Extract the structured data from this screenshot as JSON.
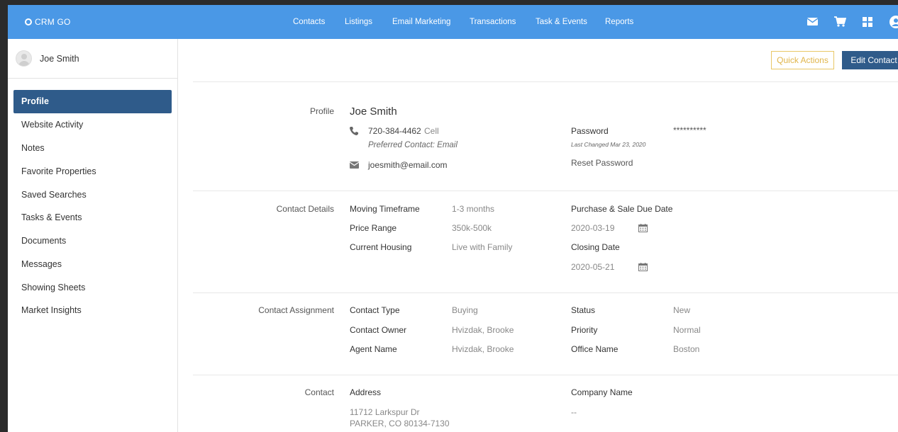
{
  "header": {
    "logo": "CRM GO",
    "nav": [
      "Contacts",
      "Listings",
      "Email Marketing",
      "Transactions",
      "Task & Events",
      "Reports"
    ],
    "icons": [
      "mail-icon",
      "cart-icon",
      "grid-icon",
      "user-icon"
    ]
  },
  "sidebar": {
    "user_name": "Joe Smith",
    "items": [
      "Profile",
      "Website Activity",
      "Notes",
      "Favorite Properties",
      "Saved Searches",
      "Tasks & Events",
      "Documents",
      "Messages",
      "Showing Sheets",
      "Market Insights"
    ]
  },
  "actions": {
    "quick": "Quick Actions",
    "edit": "Edit Contact"
  },
  "profile": {
    "section_label": "Profile",
    "name": "Joe Smith",
    "phone": "720-384-4462",
    "phone_type": "Cell",
    "preferred": "Preferred Contact: Email",
    "email": "joesmith@email.com",
    "password_label": "Password",
    "password_value": "**********",
    "password_changed": "Last Changed Mar 23, 2020",
    "reset_password": "Reset Password"
  },
  "contact_details": {
    "section_label": "Contact Details",
    "moving_timeframe_label": "Moving Timeframe",
    "moving_timeframe": "1-3 months",
    "price_range_label": "Price Range",
    "price_range": "350k-500k",
    "current_housing_label": "Current Housing",
    "current_housing": "Live with Family",
    "purchase_due_label": "Purchase & Sale Due Date",
    "purchase_due": "2020-03-19",
    "closing_date_label": "Closing Date",
    "closing_date": "2020-05-21"
  },
  "assignment": {
    "section_label": "Contact Assignment",
    "contact_type_label": "Contact Type",
    "contact_type": "Buying",
    "contact_owner_label": "Contact Owner",
    "contact_owner": "Hvizdak, Brooke",
    "agent_name_label": "Agent Name",
    "agent_name": "Hvizdak, Brooke",
    "status_label": "Status",
    "status": "New",
    "priority_label": "Priority",
    "priority": "Normal",
    "office_name_label": "Office Name",
    "office_name": "Boston"
  },
  "contact": {
    "section_label": "Contact",
    "address_label": "Address",
    "address_line1": "11712 Larkspur Dr",
    "address_line2": "PARKER, CO 80134-7130",
    "company_label": "Company Name",
    "company": "--"
  },
  "colors": {
    "topbar": "#4a98e6",
    "active": "#2f5b8a",
    "quick_border": "#e9c766"
  }
}
